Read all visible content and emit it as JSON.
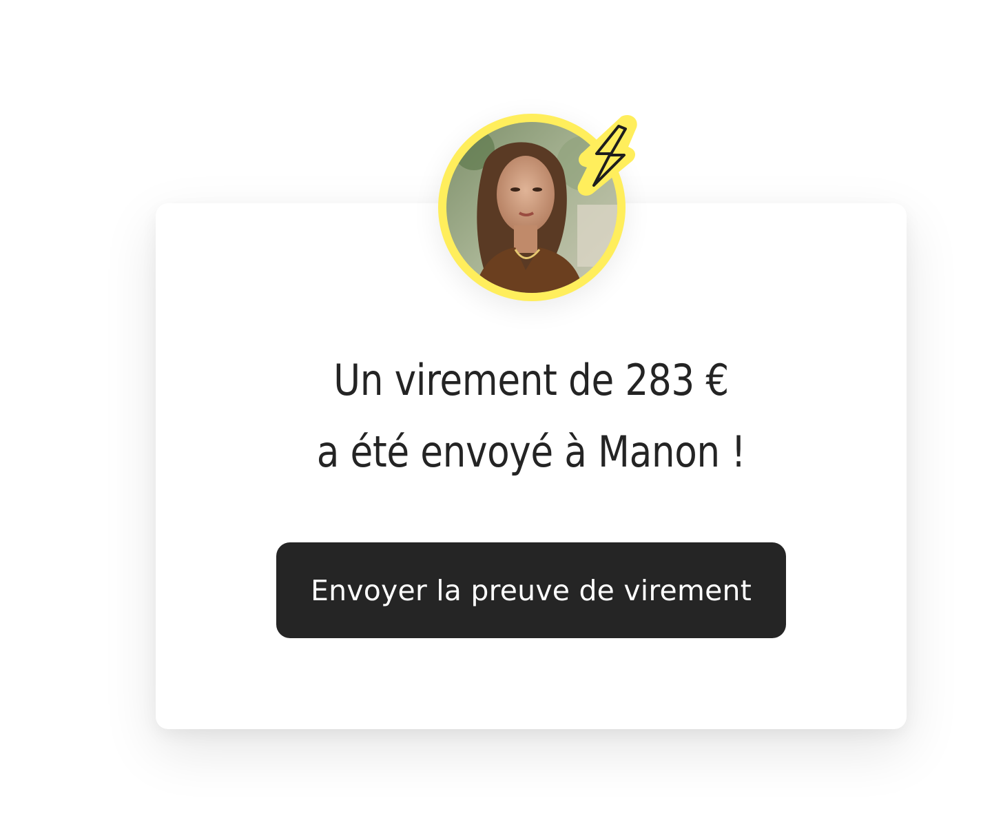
{
  "colors": {
    "accent_yellow": "#FFEE5C",
    "button_bg": "#252525",
    "button_text": "#FFFFFF",
    "text_dark": "#242424",
    "card_bg": "#FFFFFF"
  },
  "avatar": {
    "icon": "recipient-avatar-photo",
    "badge_icon": "lightning-bolt-icon"
  },
  "message": {
    "line1": "Un virement de 283 €",
    "line2": "a été envoyé à Manon !"
  },
  "cta": {
    "label": "Envoyer la preuve de virement"
  }
}
